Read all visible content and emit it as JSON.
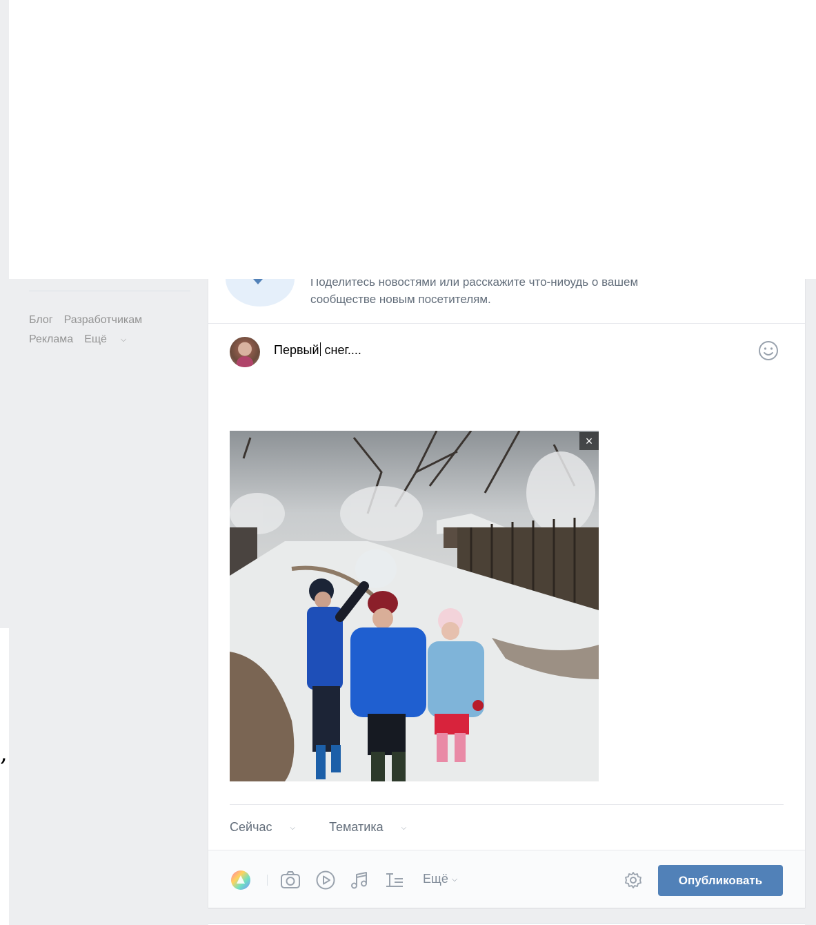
{
  "left_menu": {
    "footer_links": [
      "Блог",
      "Разработчикам",
      "Реклама"
    ],
    "more_label": "Ещё"
  },
  "promo": {
    "text_line1": "Поделитесь новостями или расскажите что-нибудь о вашем",
    "text_line2": "сообществе новым посетителям."
  },
  "composer": {
    "text_before_caret": "Первый",
    "text_after_caret": " снег....",
    "emoji_icon": "smile-icon"
  },
  "attachment": {
    "type": "photo",
    "close_label": "×"
  },
  "meta": {
    "time_label": "Сейчас",
    "topic_label": "Тематика"
  },
  "toolbar": {
    "icons": [
      "poster-colors-icon",
      "camera-icon",
      "video-play-icon",
      "music-note-icon",
      "article-icon",
      "gear-icon"
    ],
    "more_label": "Ещё",
    "publish_label": "Опубликовать"
  },
  "colors": {
    "accent": "#5181b8",
    "page_bg": "#edeef0",
    "secondary_text": "#626d7a",
    "muted_text": "#939393"
  }
}
